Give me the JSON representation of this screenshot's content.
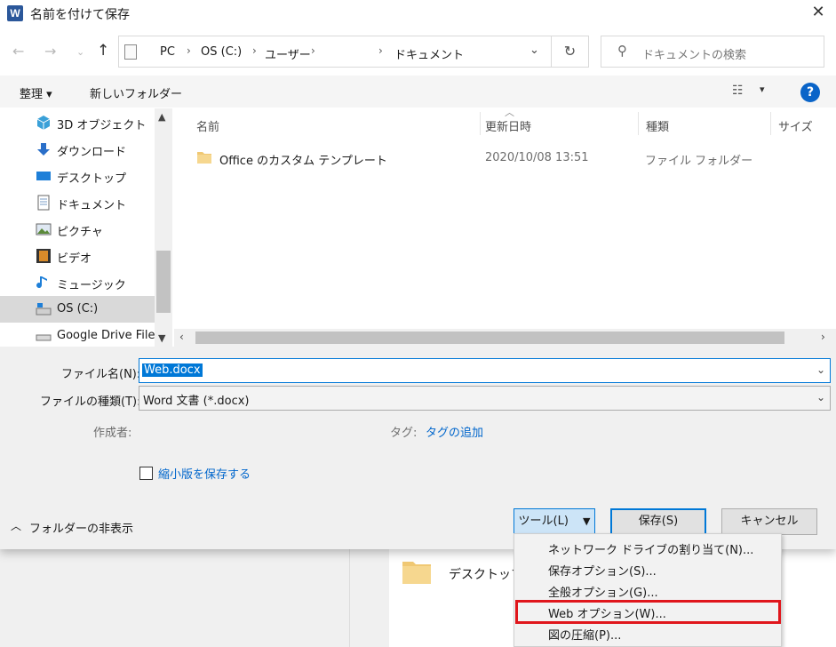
{
  "window": {
    "title": "名前を付けて保存",
    "app_icon_letter": "W"
  },
  "nav": {
    "breadcrumb": [
      "PC",
      "OS (C:)",
      "ユーザー",
      "ドキュメント"
    ],
    "search_placeholder": "ドキュメントの検索"
  },
  "toolbar": {
    "organize": "整理",
    "new_folder": "新しいフォルダー"
  },
  "sidebar": {
    "items": [
      {
        "label": "3D オブジェクト",
        "icon": "cube-icon"
      },
      {
        "label": "ダウンロード",
        "icon": "download-icon"
      },
      {
        "label": "デスクトップ",
        "icon": "desktop-icon"
      },
      {
        "label": "ドキュメント",
        "icon": "document-icon"
      },
      {
        "label": "ピクチャ",
        "icon": "picture-icon"
      },
      {
        "label": "ビデオ",
        "icon": "video-icon"
      },
      {
        "label": "ミュージック",
        "icon": "music-icon"
      },
      {
        "label": "OS (C:)",
        "icon": "drive-icon",
        "selected": true
      },
      {
        "label": "Google Drive File",
        "icon": "drive-icon"
      }
    ]
  },
  "columns": {
    "name": "名前",
    "modified": "更新日時",
    "type": "種類",
    "size": "サイズ"
  },
  "files": [
    {
      "name": "Office のカスタム テンプレート",
      "modified": "2020/10/08 13:51",
      "type": "ファイル フォルダー"
    }
  ],
  "form": {
    "filename_label": "ファイル名(N):",
    "filename_value": "Web.docx",
    "filetype_label": "ファイルの種類(T):",
    "filetype_value": "Word 文書 (*.docx)",
    "author_label": "作成者:",
    "tags_label": "タグ:",
    "tags_link": "タグの追加",
    "thumbnail_label": "縮小版を保存する",
    "hide_folders": "フォルダーの非表示"
  },
  "buttons": {
    "tools": "ツール(L)",
    "save": "保存(S)",
    "cancel": "キャンセル"
  },
  "tools_menu": [
    "ネットワーク ドライブの割り当て(N)...",
    "保存オプション(S)...",
    "全般オプション(G)...",
    "Web オプション(W)...",
    "図の圧縮(P)..."
  ],
  "background": {
    "folder_label": "デスクトップ"
  },
  "colors": {
    "accent": "#0078d7",
    "highlight_box": "#e0161c",
    "word_blue": "#2b579a"
  }
}
